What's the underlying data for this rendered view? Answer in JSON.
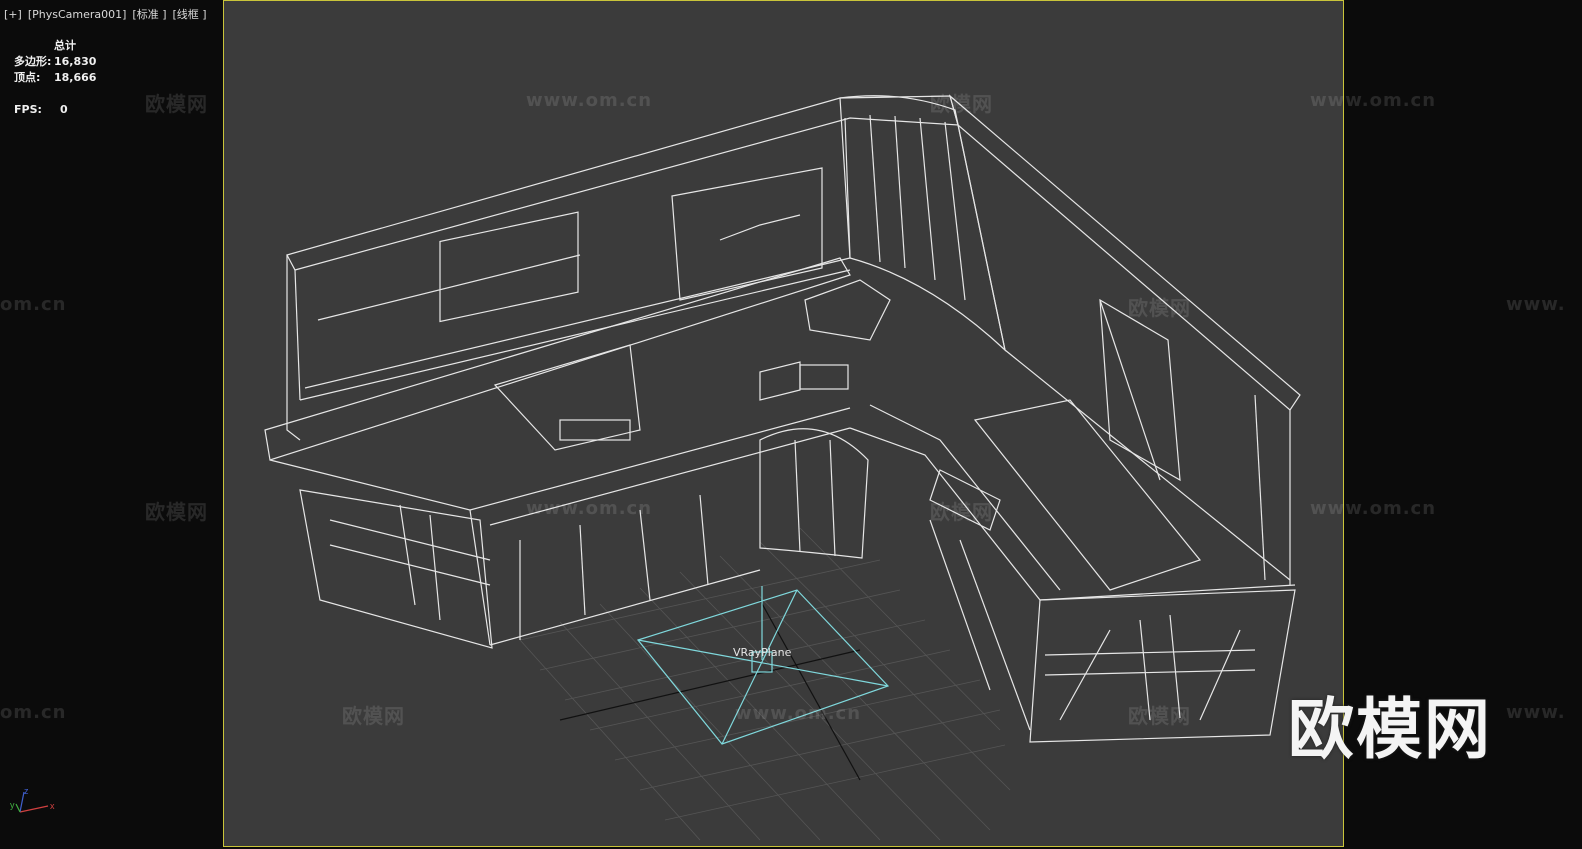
{
  "viewport": {
    "menu": "[+]",
    "camera": "[PhysCamera001]",
    "shading_standard": "[标准 ]",
    "shading_mode": "[线框 ]"
  },
  "stats": {
    "header": "总计",
    "polygons_label": "多边形:",
    "polygons_value": "16,830",
    "vertices_label": "顶点:",
    "vertices_value": "18,666",
    "fps_label": "FPS:",
    "fps_value": "0"
  },
  "scene": {
    "object_label": "VRayPlane",
    "object_color": "#7fd8dc",
    "wire_color": "#e6e6e6",
    "frame_color": "#c9c43a"
  },
  "watermarks": {
    "cn": "欧模网",
    "url": "www.om.cn",
    "url_short": "om.cn",
    "url_prefix": "www."
  },
  "axis": {
    "x": "x",
    "y": "y",
    "z": "z"
  }
}
